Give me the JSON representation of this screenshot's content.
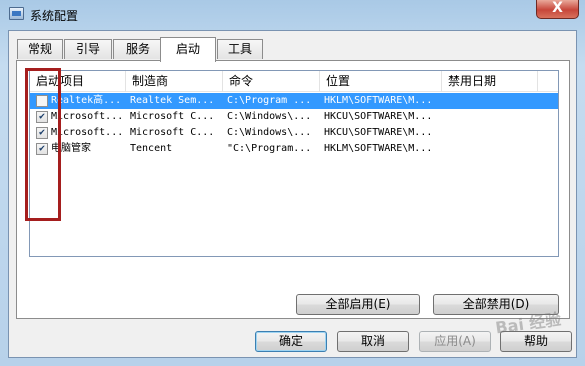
{
  "window": {
    "title": "系统配置",
    "close_glyph": "X"
  },
  "tabs": [
    {
      "label": "常规",
      "active": false
    },
    {
      "label": "引导",
      "active": false
    },
    {
      "label": "服务",
      "active": false
    },
    {
      "label": "启动",
      "active": true
    },
    {
      "label": "工具",
      "active": false
    }
  ],
  "table": {
    "headers": [
      "启动项目",
      "制造商",
      "命令",
      "位置",
      "禁用日期"
    ],
    "rows": [
      {
        "checked": false,
        "selected": true,
        "item": "Realtek高...",
        "maker": "Realtek Sem...",
        "command": "C:\\Program ...",
        "location": "HKLM\\SOFTWARE\\M...",
        "date": ""
      },
      {
        "checked": true,
        "selected": false,
        "item": "Microsoft...",
        "maker": "Microsoft C...",
        "command": "C:\\Windows\\...",
        "location": "HKCU\\SOFTWARE\\M...",
        "date": ""
      },
      {
        "checked": true,
        "selected": false,
        "item": "Microsoft...",
        "maker": "Microsoft C...",
        "command": "C:\\Windows\\...",
        "location": "HKCU\\SOFTWARE\\M...",
        "date": ""
      },
      {
        "checked": true,
        "selected": false,
        "item": "电脑管家",
        "maker": "Tencent",
        "command": "\"C:\\Program...",
        "location": "HKLM\\SOFTWARE\\M...",
        "date": ""
      }
    ]
  },
  "buttons": {
    "enable_all": "全部启用(E)",
    "disable_all": "全部禁用(D)",
    "ok": "确定",
    "cancel": "取消",
    "apply": "应用(A)",
    "help": "帮助"
  },
  "watermark": "Bai 经验",
  "colors": {
    "selection": "#3399ff",
    "highlight_box": "#a51e1e"
  }
}
